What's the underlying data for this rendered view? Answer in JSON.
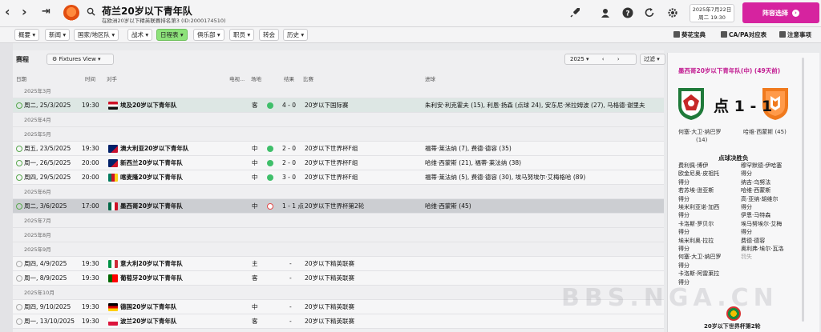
{
  "topbar": {
    "title": "荷兰20岁以下青年队",
    "subtitle": "在欧洲20岁以下精英联赛排名第3 (ID:2000174510)",
    "date_line1": "2025年7月22日",
    "date_line2": "周二 19:30",
    "continue_label": "阵容选择"
  },
  "menu": {
    "tabs": [
      "概要",
      "新闻",
      "国家/地区队",
      "战术",
      "日程表",
      "俱乐部",
      "职员",
      "转会",
      "历史"
    ],
    "right_links": [
      "葵花宝典",
      "CA/PA对应表",
      "注意事项"
    ]
  },
  "fixtures": {
    "panel_title": "赛程",
    "view_label": "Fixtures View",
    "year": "2025",
    "filter_label": "过滤",
    "columns": [
      "日期",
      "时间",
      "对手",
      "电视...",
      "场地",
      "结果",
      "比赛",
      "进球"
    ],
    "rows": [
      {
        "type": "month",
        "label": "2025年3月"
      },
      {
        "type": "match",
        "date": "周二, 25/3/2025",
        "time": "19:30",
        "opponent": "埃及20岁以下青年队",
        "venue": "客",
        "result": "4 - 0",
        "competition": "20岁以下国际赛",
        "scorers": "朱利安·利克霍夫 (15), 利恩·扬森 (点球 24), 安东尼·米拉姆波 (27), 马格德·谢里夫",
        "flag": "egypt",
        "status": "win",
        "sel": true
      },
      {
        "type": "month",
        "label": "2025年4月"
      },
      {
        "type": "month",
        "label": "2025年5月"
      },
      {
        "type": "match",
        "date": "周五, 23/5/2025",
        "time": "19:30",
        "opponent": "澳大利亚20岁以下青年队",
        "venue": "中",
        "result": "2 - 0",
        "competition": "20岁以下世界杯F组",
        "scorers": "福蒂·莱法纳 (7), 费德·德容 (35)",
        "flag": "australia",
        "status": "win"
      },
      {
        "type": "match",
        "date": "周一, 26/5/2025",
        "time": "20:00",
        "opponent": "新西兰20岁以下青年队",
        "venue": "中",
        "result": "2 - 0",
        "competition": "20岁以下世界杯F组",
        "scorers": "哈维·西蒙斯 (21), 福蒂·莱法纳 (38)",
        "flag": "newzealand",
        "status": "win"
      },
      {
        "type": "match",
        "date": "周四, 29/5/2025",
        "time": "20:00",
        "opponent": "喀麦隆20岁以下青年队",
        "venue": "中",
        "result": "3 - 0",
        "competition": "20岁以下世界杯F组",
        "scorers": "福蒂·莱法纳 (5), 费德·德容 (30), 埃马努埃尔·艾梅格哈 (89)",
        "flag": "cameroon",
        "status": "win"
      },
      {
        "type": "month",
        "label": "2025年6月"
      },
      {
        "type": "match",
        "date": "周二, 3/6/2025",
        "time": "17:00",
        "opponent": "墨西哥20岁以下青年队",
        "venue": "中",
        "result": "1 - 1 点",
        "competition": "20岁以下世界杯第2轮",
        "scorers": "哈维·西蒙斯 (45)",
        "flag": "mexico",
        "status": "draw",
        "highlight": true
      },
      {
        "type": "month",
        "label": "2025年7月"
      },
      {
        "type": "month",
        "label": "2025年8月"
      },
      {
        "type": "month",
        "label": "2025年9月"
      },
      {
        "type": "match",
        "date": "周四, 4/9/2025",
        "time": "19:30",
        "opponent": "意大利20岁以下青年队",
        "venue": "主",
        "result": "-",
        "competition": "20岁以下精英联赛",
        "scorers": "",
        "flag": "italy",
        "status": "none"
      },
      {
        "type": "match",
        "date": "周一, 8/9/2025",
        "time": "19:30",
        "opponent": "葡萄牙20岁以下青年队",
        "venue": "客",
        "result": "-",
        "competition": "20岁以下精英联赛",
        "scorers": "",
        "flag": "portugal",
        "status": "none"
      },
      {
        "type": "month",
        "label": "2025年10月"
      },
      {
        "type": "match",
        "date": "周四, 9/10/2025",
        "time": "19:30",
        "opponent": "德国20岁以下青年队",
        "venue": "中",
        "result": "-",
        "competition": "20岁以下精英联赛",
        "scorers": "",
        "flag": "germany",
        "status": "none"
      },
      {
        "type": "match",
        "date": "周一, 13/10/2025",
        "time": "19:30",
        "opponent": "波兰20岁以下青年队",
        "venue": "客",
        "result": "-",
        "competition": "20岁以下精英联赛",
        "scorers": "",
        "flag": "poland",
        "status": "none"
      }
    ]
  },
  "match_detail": {
    "header": "墨西哥20岁以下青年队(中) (49天前)",
    "score": "点 1 - 1",
    "home_scorer": "何塞·大卫·纳巴罗",
    "home_scorer_min": "(14)",
    "away_scorer": "哈维·西蒙斯 (45)",
    "penalty_title": "点球决胜负",
    "penalties": [
      {
        "home": "费利佩·博伊",
        "away": "穆罕默德·伊哈塞"
      },
      {
        "home": "欧金尼奥·皮祖托",
        "away": "得分"
      },
      {
        "home": "得分",
        "away": "纳吉·乌努法"
      },
      {
        "home": "若苏埃·逊亚斯",
        "away": "哈维·西蒙斯"
      },
      {
        "home": "得分",
        "away": "高·亚纳·胡维尔"
      },
      {
        "home": "埃米利亚诺·加西",
        "away": "得分"
      },
      {
        "home": "得分",
        "away": "伊恩·马特森"
      },
      {
        "home": "卡洛斯·罗贝尔",
        "away": "埃马努埃尔·艾梅"
      },
      {
        "home": "得分",
        "away": "得分"
      },
      {
        "home": "埃米利奥·拉拉",
        "away": "费德·德容"
      },
      {
        "home": "得分",
        "away": "奥利弗·埃尔·瓦洛"
      },
      {
        "home": "何塞·大卫·纳巴罗",
        "away": "罚失"
      },
      {
        "home": "得分",
        "away": ""
      },
      {
        "home": "卡洛斯·阿雷莱拉",
        "away": ""
      },
      {
        "home": "得分",
        "away": ""
      }
    ],
    "competition": "20岁以下世界杯第2轮"
  },
  "watermark": "BBS.NGA.CN",
  "colors": {
    "accent": "#d6239f",
    "active_tab": "#8de27a",
    "win_dot": "#3fbf6a",
    "draw_dot": "#e24a4a"
  }
}
